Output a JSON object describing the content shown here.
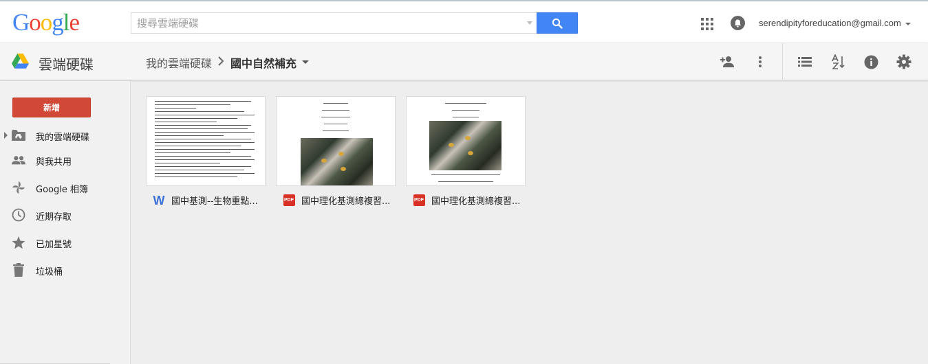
{
  "header": {
    "logo_letters": [
      "G",
      "o",
      "o",
      "g",
      "l",
      "e"
    ],
    "search_placeholder": "搜尋雲端硬碟",
    "account_email": "serendipityforeducation@gmail.com"
  },
  "subbar": {
    "app_title": "雲端硬碟",
    "breadcrumb_root": "我的雲端硬碟",
    "breadcrumb_current": "國中自然補充"
  },
  "sidebar": {
    "new_button": "新增",
    "items": [
      {
        "label": "我的雲端硬碟",
        "icon": "my-drive-icon"
      },
      {
        "label": "與我共用",
        "icon": "shared-with-me-icon"
      },
      {
        "label": "Google 相簿",
        "icon": "google-photos-icon"
      },
      {
        "label": "近期存取",
        "icon": "recent-icon"
      },
      {
        "label": "已加星號",
        "icon": "starred-icon"
      },
      {
        "label": "垃圾桶",
        "icon": "trash-icon"
      }
    ]
  },
  "files": [
    {
      "name": "國中基測--生物重點...",
      "type": "word",
      "type_label": "W"
    },
    {
      "name": "國中理化基測總複習...",
      "type": "pdf",
      "type_label": "PDF"
    },
    {
      "name": "國中理化基測總複習...",
      "type": "pdf",
      "type_label": "PDF"
    }
  ],
  "colors": {
    "search_button": "#4285f4",
    "new_button": "#d14836",
    "google_blue": "#4285f4",
    "google_red": "#ea4335",
    "google_yellow": "#fbbc05",
    "google_green": "#34a853"
  }
}
